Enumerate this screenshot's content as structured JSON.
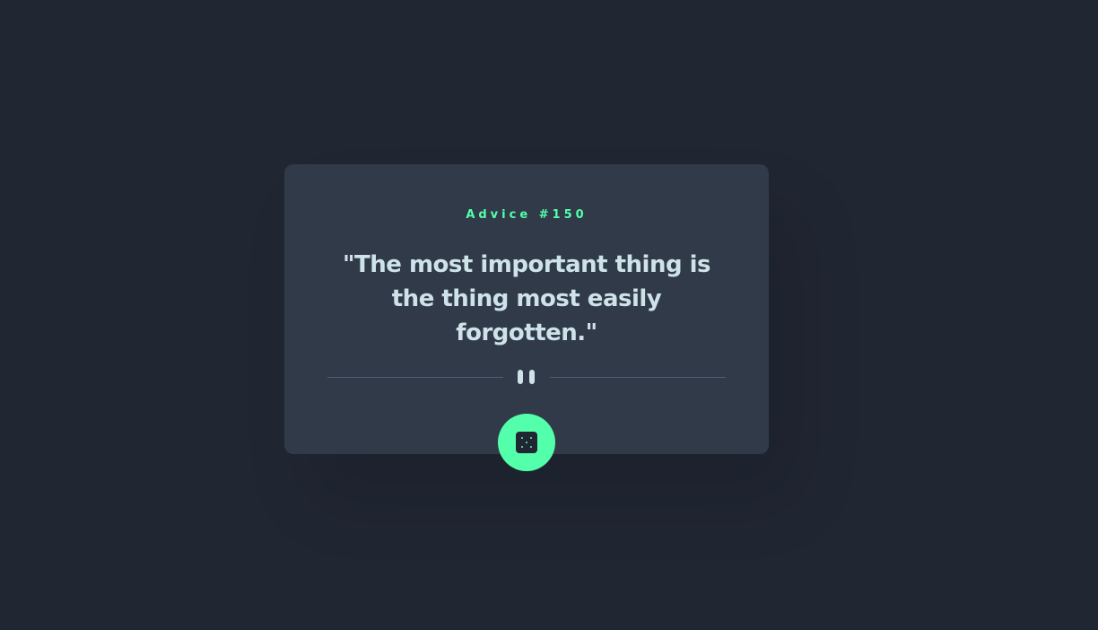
{
  "card": {
    "advice_label": "Advice #150",
    "quote": "\"The most important thing is the thing most easily forgotten.\""
  },
  "divider": {
    "icon": "pause-icon"
  },
  "button": {
    "icon": "dice-icon"
  },
  "colors": {
    "background": "#202632",
    "card": "#313a48",
    "accent": "#53ffaa",
    "text": "#cee3e9",
    "divider": "#4f5d74"
  }
}
